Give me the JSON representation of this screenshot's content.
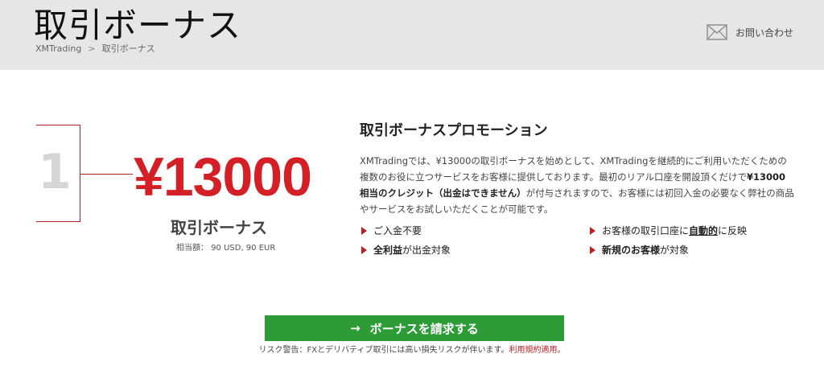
{
  "header": {
    "title": "取引ボーナス",
    "breadcrumb": [
      "XMTrading",
      "取引ボーナス"
    ],
    "breadcrumb_separator": ">",
    "contact_label": "お問い合わせ",
    "contact_icon": "envelope-icon"
  },
  "bonus": {
    "step": "1",
    "amount": "¥13000",
    "label": "取引ボーナス",
    "equivalent": "相当額： 90 USD, 90 EUR"
  },
  "promo": {
    "title": "取引ボーナスプロモーション",
    "body_part1": "XMTradingでは、¥13000の取引ボーナスを始めとして、XMTradingを継続的にご利用いただくための複数のお役に立つサービスをお客様に提供しております。最初のリアル口座を開設頂くだけで",
    "body_bold": "¥13000相当のクレジット（出金はできません）",
    "body_part2": "が付与されますので、お客様には初回入金の必要なく弊社の商品やサービスをお試しいただくことが可能です。"
  },
  "features": [
    {
      "pre": "ご入金不要",
      "bold": "",
      "post": ""
    },
    {
      "pre": "お客様の取引口座に",
      "bold": "自動的",
      "post": "に反映"
    },
    {
      "pre": "",
      "bold": "全利益",
      "post": "が出金対象"
    },
    {
      "pre": "",
      "bold": "新規のお客様",
      "post": "が対象"
    }
  ],
  "cta": {
    "arrow": "→",
    "label": "ボーナスを請求する"
  },
  "risk": {
    "text": "リスク警告：FXとデリバティブ取引には高い損失リスクが伴います。",
    "link": "利用規約適用。"
  },
  "colors": {
    "accent_red": "#d51f26",
    "cta_green": "#2e9c36",
    "header_bg": "#e6e6e6"
  }
}
